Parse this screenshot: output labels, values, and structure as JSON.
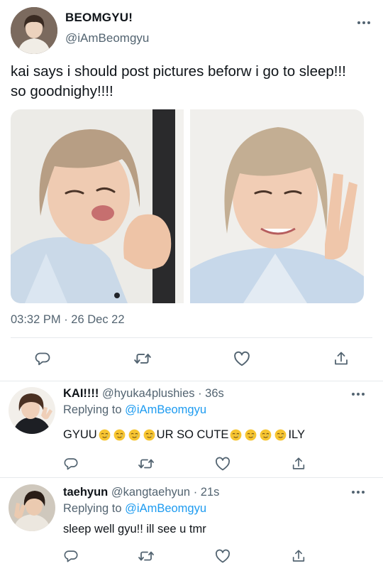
{
  "main_tweet": {
    "display_name": "BEOMGYU!",
    "handle": "@iAmBeomgyu",
    "text": "kai says i should post pictures beforw i go to sleep!!! so goodnighy!!!!",
    "timestamp": "03:32 PM · 26 Dec 22",
    "photos": [
      "photo-1",
      "photo-2"
    ],
    "action_icons": [
      "reply-icon",
      "retweet-icon",
      "like-icon",
      "share-icon"
    ]
  },
  "replies": [
    {
      "display_name": "KAI!!!!",
      "handle": "@hyuka4plushies",
      "time": "· 36s",
      "replying_prefix": "Replying to",
      "replying_to": "@iAmBeomgyu",
      "text_parts": [
        "GYUU",
        " UR SO CUTE",
        " ILY"
      ],
      "emoji": "smiling-face-with-tear"
    },
    {
      "display_name": "taehyun",
      "handle": "@kangtaehyun",
      "time": "· 21s",
      "replying_prefix": "Replying to",
      "replying_to": "@iAmBeomgyu",
      "text": "sleep well gyu!! ill see u tmr"
    }
  ],
  "colors": {
    "text": "#0f1419",
    "secondary": "#536471",
    "link": "#1d9bf0",
    "divider": "#e6e9ec",
    "emoji": "#f7c531"
  }
}
